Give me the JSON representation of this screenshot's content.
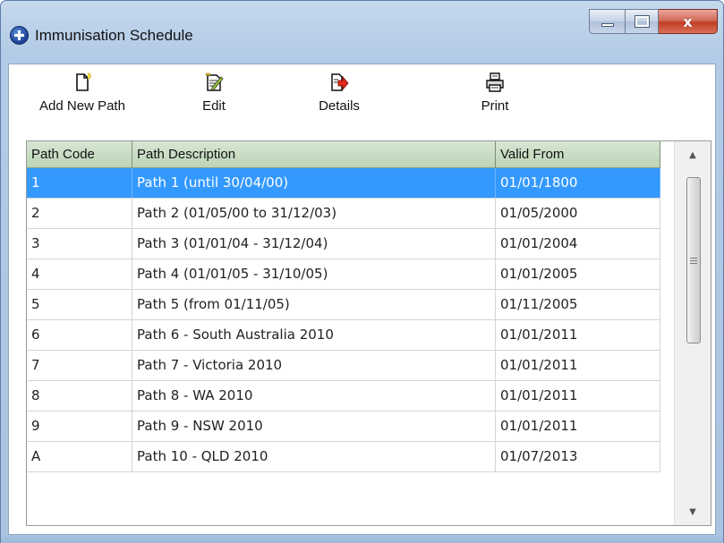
{
  "window": {
    "title": "Immunisation Schedule",
    "close_glyph": "x"
  },
  "toolbar": {
    "add_label": "Add New Path",
    "edit_label": "Edit",
    "details_label": "Details",
    "print_label": "Print"
  },
  "grid": {
    "columns": [
      "Path Code",
      "Path Description",
      "Valid From"
    ],
    "selected_row": 0,
    "rows": [
      {
        "code": "1",
        "description": "Path 1 (until 30/04/00)",
        "valid_from": "01/01/1800"
      },
      {
        "code": "2",
        "description": "Path 2 (01/05/00 to 31/12/03)",
        "valid_from": "01/05/2000"
      },
      {
        "code": "3",
        "description": "Path 3 (01/01/04 - 31/12/04)",
        "valid_from": "01/01/2004"
      },
      {
        "code": "4",
        "description": "Path 4 (01/01/05 - 31/10/05)",
        "valid_from": "01/01/2005"
      },
      {
        "code": "5",
        "description": "Path 5 (from 01/11/05)",
        "valid_from": "01/11/2005"
      },
      {
        "code": "6",
        "description": "Path 6 - South Australia 2010",
        "valid_from": "01/01/2011"
      },
      {
        "code": "7",
        "description": "Path 7 - Victoria 2010",
        "valid_from": "01/01/2011"
      },
      {
        "code": "8",
        "description": "Path 8 - WA 2010",
        "valid_from": "01/01/2011"
      },
      {
        "code": "9",
        "description": "Path 9 - NSW 2010",
        "valid_from": "01/01/2011"
      },
      {
        "code": "A",
        "description": "Path 10 - QLD 2010",
        "valid_from": "01/07/2013"
      }
    ]
  },
  "icons": {
    "app": "medical-cross-icon",
    "add": "new-document-icon",
    "edit": "edit-document-icon",
    "details": "details-arrow-icon",
    "print": "printer-icon"
  },
  "colors": {
    "selection": "#3399ff",
    "header": "#c8ddc4",
    "close_button": "#c94a34"
  }
}
